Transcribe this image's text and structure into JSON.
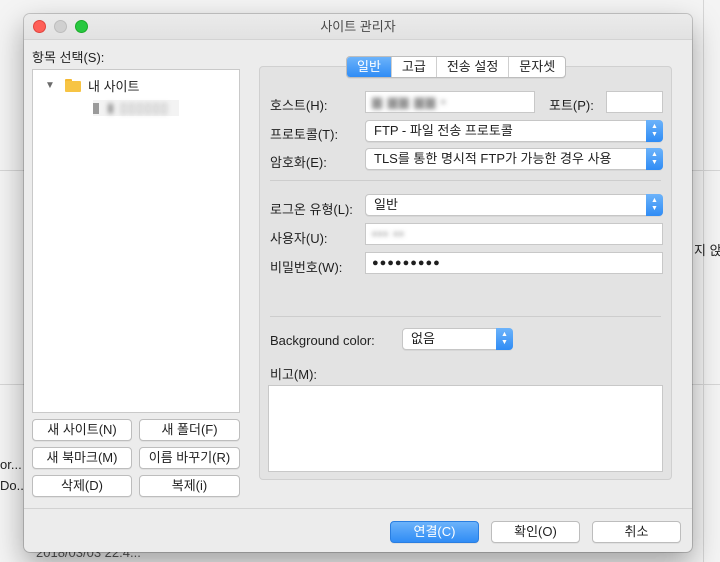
{
  "background": {
    "partial_texts": [
      "지 앉",
      "or...",
      "Do...",
      "2018/03/03 22:4..."
    ]
  },
  "window": {
    "title": "사이트 관리자"
  },
  "tree": {
    "label": "항목 선택(S):",
    "root": {
      "label": "내 사이트",
      "icon": "folder-icon",
      "expanded": true
    },
    "sites": [
      {
        "label": "▮ ▯▯▯▯▯▯",
        "redacted": true
      }
    ]
  },
  "left_buttons": {
    "new_site": "새 사이트(N)",
    "new_folder": "새 폴더(F)",
    "new_bookmark": "새 북마크(M)",
    "rename": "이름 바꾸기(R)",
    "delete": "삭제(D)",
    "duplicate": "복제(i)"
  },
  "tabs": [
    {
      "label": "일반",
      "active": true
    },
    {
      "label": "고급",
      "active": false
    },
    {
      "label": "전송 설정",
      "active": false
    },
    {
      "label": "문자셋",
      "active": false
    }
  ],
  "general": {
    "host_label": "호스트(H):",
    "host_value": "▆ ▆▆ ▆▆ ▪",
    "port_label": "포트(P):",
    "port_value": "",
    "protocol_label": "프로토콜(T):",
    "protocol_value": "FTP - 파일 전송 프로토콜",
    "encryption_label": "암호화(E):",
    "encryption_value": "TLS를 통한 명시적 FTP가 가능한 경우 사용",
    "logon_label": "로그온 유형(L):",
    "logon_value": "일반",
    "user_label": "사용자(U):",
    "user_value": "▪▪▪ ▪▪",
    "password_label": "비밀번호(W):",
    "password_value": "●●●●●●●●●",
    "bgcolor_label": "Background color:",
    "bgcolor_value": "없음",
    "comments_label": "비고(M):",
    "comments_value": ""
  },
  "footer": {
    "connect": "연결(C)",
    "ok": "확인(O)",
    "cancel": "취소"
  },
  "colors": {
    "accent": "#2f8cf5",
    "close": "#ff5f57",
    "maximize": "#28c840",
    "folder": "#f7c444"
  }
}
